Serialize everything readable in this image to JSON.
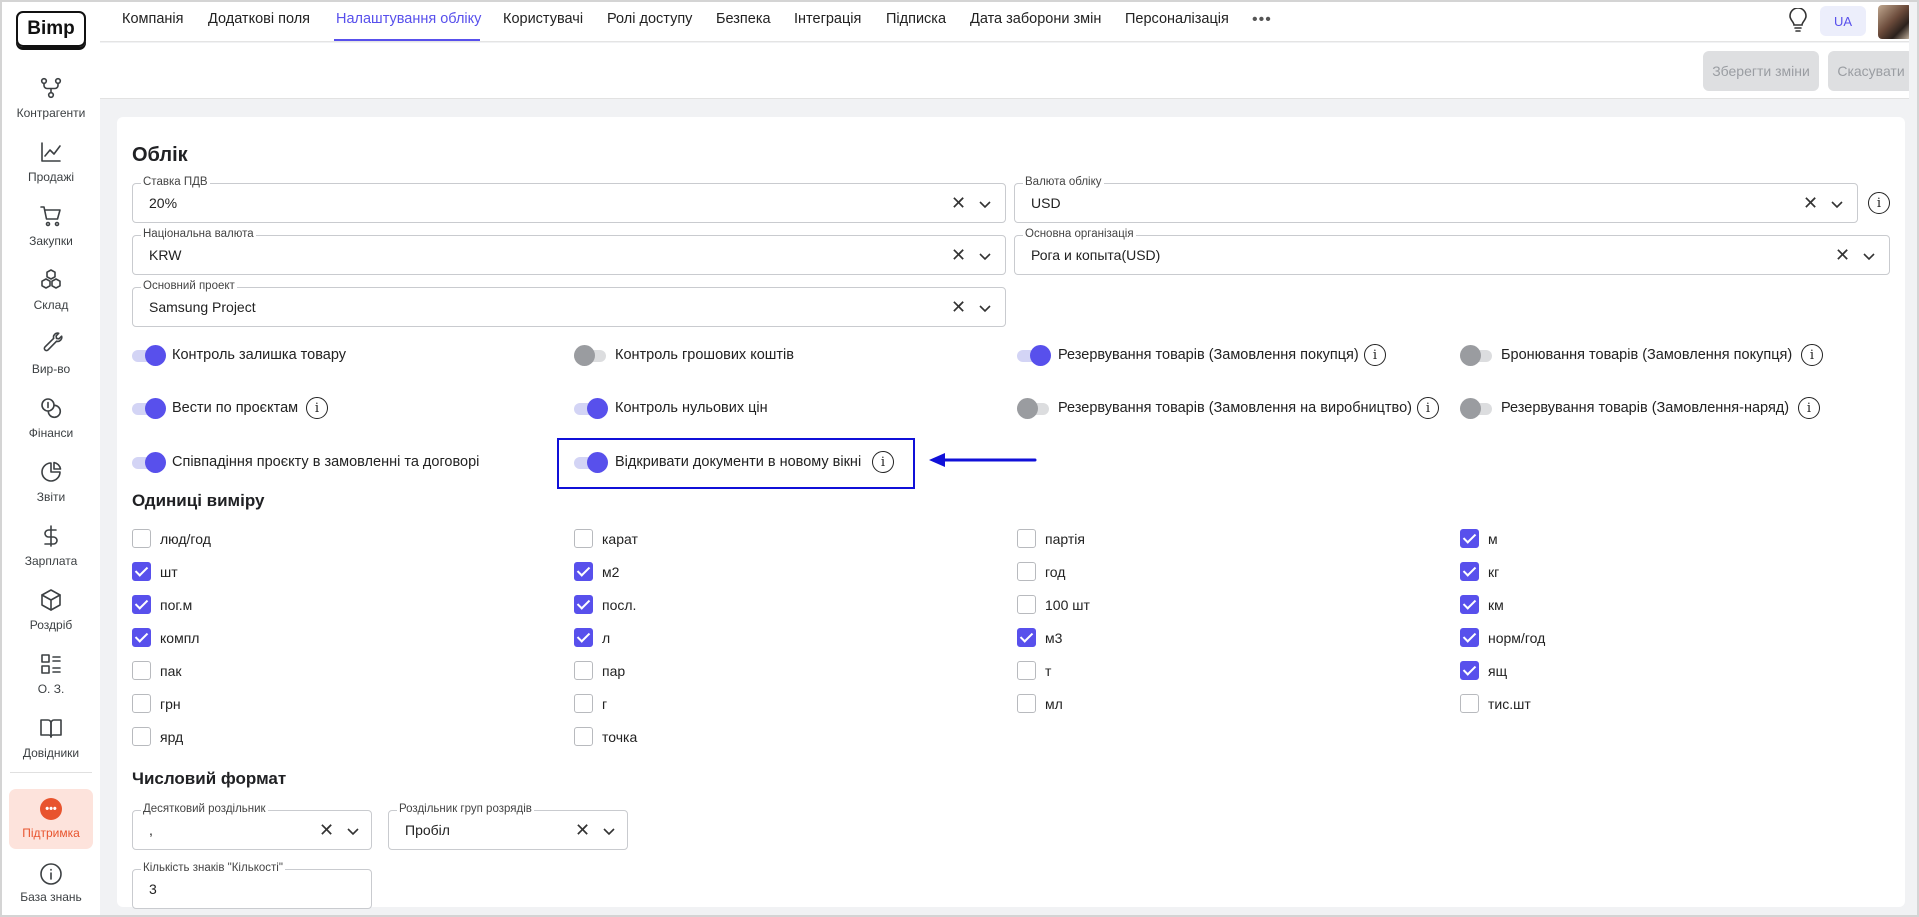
{
  "brand": "Bimp",
  "sidebar": {
    "items": [
      {
        "label": "Контрагенти",
        "icon": "branch-icon"
      },
      {
        "label": "Продажі",
        "icon": "chart-line-icon"
      },
      {
        "label": "Закупки",
        "icon": "cart-icon"
      },
      {
        "label": "Склад",
        "icon": "boxes-icon"
      },
      {
        "label": "Вир-во",
        "icon": "wrench-icon"
      },
      {
        "label": "Фінанси",
        "icon": "coins-icon"
      },
      {
        "label": "Звіти",
        "icon": "pie-chart-icon"
      },
      {
        "label": "Зарплата",
        "icon": "dollar-icon"
      },
      {
        "label": "Роздріб",
        "icon": "box-icon"
      },
      {
        "label": "О. З.",
        "icon": "list-icon"
      },
      {
        "label": "Довідники",
        "icon": "book-icon"
      }
    ],
    "support_label": "Підтримка",
    "knowledge_label": "База знань"
  },
  "tabs": [
    {
      "label": "Компанія"
    },
    {
      "label": "Додаткові поля"
    },
    {
      "label": "Налаштування обліку",
      "active": true
    },
    {
      "label": "Користувачі"
    },
    {
      "label": "Ролі доступу"
    },
    {
      "label": "Безпека"
    },
    {
      "label": "Інтеграція"
    },
    {
      "label": "Підписка"
    },
    {
      "label": "Дата заборони змін"
    },
    {
      "label": "Персоналізація"
    }
  ],
  "more_label": "•••",
  "language": "UA",
  "actions": {
    "save_label": "Зберегти зміни",
    "cancel_label": "Скасувати"
  },
  "accounting": {
    "title": "Облік",
    "fields": {
      "vat": {
        "label": "Ставка ПДВ",
        "value": "20%"
      },
      "currency": {
        "label": "Валюта обліку",
        "value": "USD"
      },
      "national_currency": {
        "label": "Національна валюта",
        "value": "KRW"
      },
      "main_org": {
        "label": "Основна організація",
        "value": "Рога и копыта(USD)"
      },
      "main_project": {
        "label": "Основний проект",
        "value": "Samsung Project"
      }
    },
    "toggles": [
      {
        "label": "Контроль залишка товару",
        "on": true
      },
      {
        "label": "Контроль грошових коштів",
        "on": false
      },
      {
        "label": "Резервування товарів (Замовлення покупця)",
        "on": true
      },
      {
        "label": "Бронювання товарів (Замовлення покупця)",
        "on": false
      },
      {
        "label": "Вести по проєктам",
        "on": true
      },
      {
        "label": "Контроль нульових цін",
        "on": true
      },
      {
        "label": "Резервування товарів (Замовлення на виробництво)",
        "on": false
      },
      {
        "label": "Резервування товарів (Замовлення-наряд)",
        "on": false
      },
      {
        "label": "Співпадіння проєкту в замовленні та договорі",
        "on": true
      },
      {
        "label": "Відкривати документи в новому вікні",
        "on": true
      }
    ]
  },
  "units": {
    "title": "Одиниці виміру",
    "columns": [
      [
        {
          "label": "люд/год",
          "checked": false
        },
        {
          "label": "шт",
          "checked": true
        },
        {
          "label": "пог.м",
          "checked": true
        },
        {
          "label": "компл",
          "checked": true
        },
        {
          "label": "пак",
          "checked": false
        },
        {
          "label": "грн",
          "checked": false
        },
        {
          "label": "ярд",
          "checked": false
        }
      ],
      [
        {
          "label": "карат",
          "checked": false
        },
        {
          "label": "м2",
          "checked": true
        },
        {
          "label": "посл.",
          "checked": true
        },
        {
          "label": "л",
          "checked": true
        },
        {
          "label": "пар",
          "checked": false
        },
        {
          "label": "г",
          "checked": false
        },
        {
          "label": "точка",
          "checked": false
        }
      ],
      [
        {
          "label": "партія",
          "checked": false
        },
        {
          "label": "год",
          "checked": false
        },
        {
          "label": "100 шт",
          "checked": false
        },
        {
          "label": "м3",
          "checked": true
        },
        {
          "label": "т",
          "checked": false
        },
        {
          "label": "мл",
          "checked": false
        }
      ],
      [
        {
          "label": "м",
          "checked": true
        },
        {
          "label": "кг",
          "checked": true
        },
        {
          "label": "км",
          "checked": true
        },
        {
          "label": "норм/год",
          "checked": true
        },
        {
          "label": "ящ",
          "checked": true
        },
        {
          "label": "тис.шт",
          "checked": false
        }
      ]
    ]
  },
  "number_format": {
    "title": "Числовий формат",
    "decimal_sep": {
      "label": "Десятковий роздільник",
      "value": ","
    },
    "group_sep": {
      "label": "Роздільник груп розрядів",
      "value": "Пробіл"
    },
    "qty_digits": {
      "label": "Кількість знаків \"Кількості\"",
      "value": "3"
    }
  },
  "colors": {
    "accent": "#5850ec",
    "annotation": "#1010d8",
    "support": "#e8542e"
  }
}
